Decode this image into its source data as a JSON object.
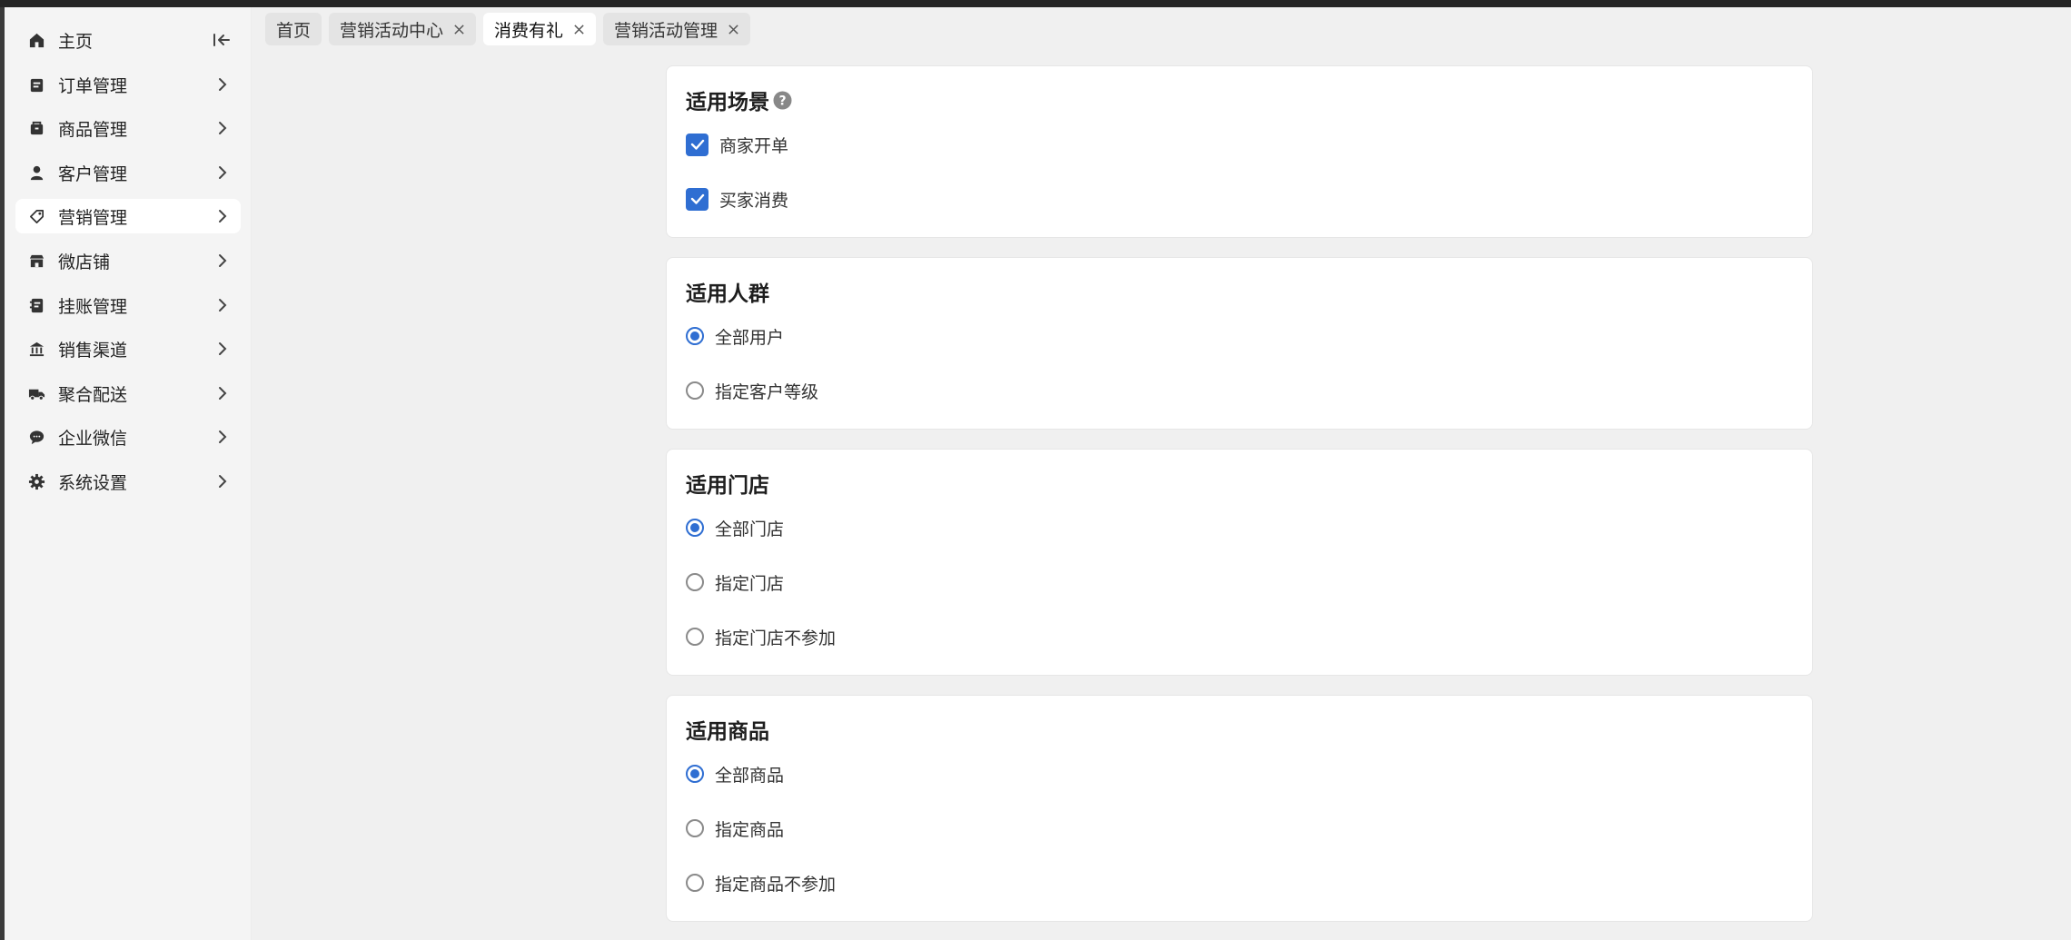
{
  "sidebar": {
    "items": [
      {
        "label": "主页",
        "icon": "home-icon"
      },
      {
        "label": "订单管理",
        "icon": "order-icon"
      },
      {
        "label": "商品管理",
        "icon": "box-icon"
      },
      {
        "label": "客户管理",
        "icon": "user-icon"
      },
      {
        "label": "营销管理",
        "icon": "tag-icon",
        "active": true
      },
      {
        "label": "微店铺",
        "icon": "shop-icon"
      },
      {
        "label": "挂账管理",
        "icon": "ledger-icon"
      },
      {
        "label": "销售渠道",
        "icon": "bank-icon"
      },
      {
        "label": "聚合配送",
        "icon": "truck-icon"
      },
      {
        "label": "企业微信",
        "icon": "chat-icon"
      },
      {
        "label": "系统设置",
        "icon": "gear-icon"
      }
    ]
  },
  "tabs": [
    {
      "label": "首页",
      "closable": false
    },
    {
      "label": "营销活动中心",
      "closable": true
    },
    {
      "label": "消费有礼",
      "closable": true,
      "active": true
    },
    {
      "label": "营销活动管理",
      "closable": true
    }
  ],
  "sections": {
    "scene": {
      "title": "适用场景",
      "options": [
        {
          "label": "商家开单",
          "checked": true
        },
        {
          "label": "买家消费",
          "checked": true
        }
      ]
    },
    "crowd": {
      "title": "适用人群",
      "options": [
        {
          "label": "全部用户",
          "checked": true
        },
        {
          "label": "指定客户等级",
          "checked": false
        }
      ]
    },
    "store": {
      "title": "适用门店",
      "options": [
        {
          "label": "全部门店",
          "checked": true
        },
        {
          "label": "指定门店",
          "checked": false
        },
        {
          "label": "指定门店不参加",
          "checked": false
        }
      ]
    },
    "goods": {
      "title": "适用商品",
      "options": [
        {
          "label": "全部商品",
          "checked": true
        },
        {
          "label": "指定商品",
          "checked": false
        },
        {
          "label": "指定商品不参加",
          "checked": false
        }
      ]
    }
  },
  "colors": {
    "accent": "#2f6ed2",
    "page_bg": "#f0f0f0",
    "card_bg": "#ffffff"
  }
}
